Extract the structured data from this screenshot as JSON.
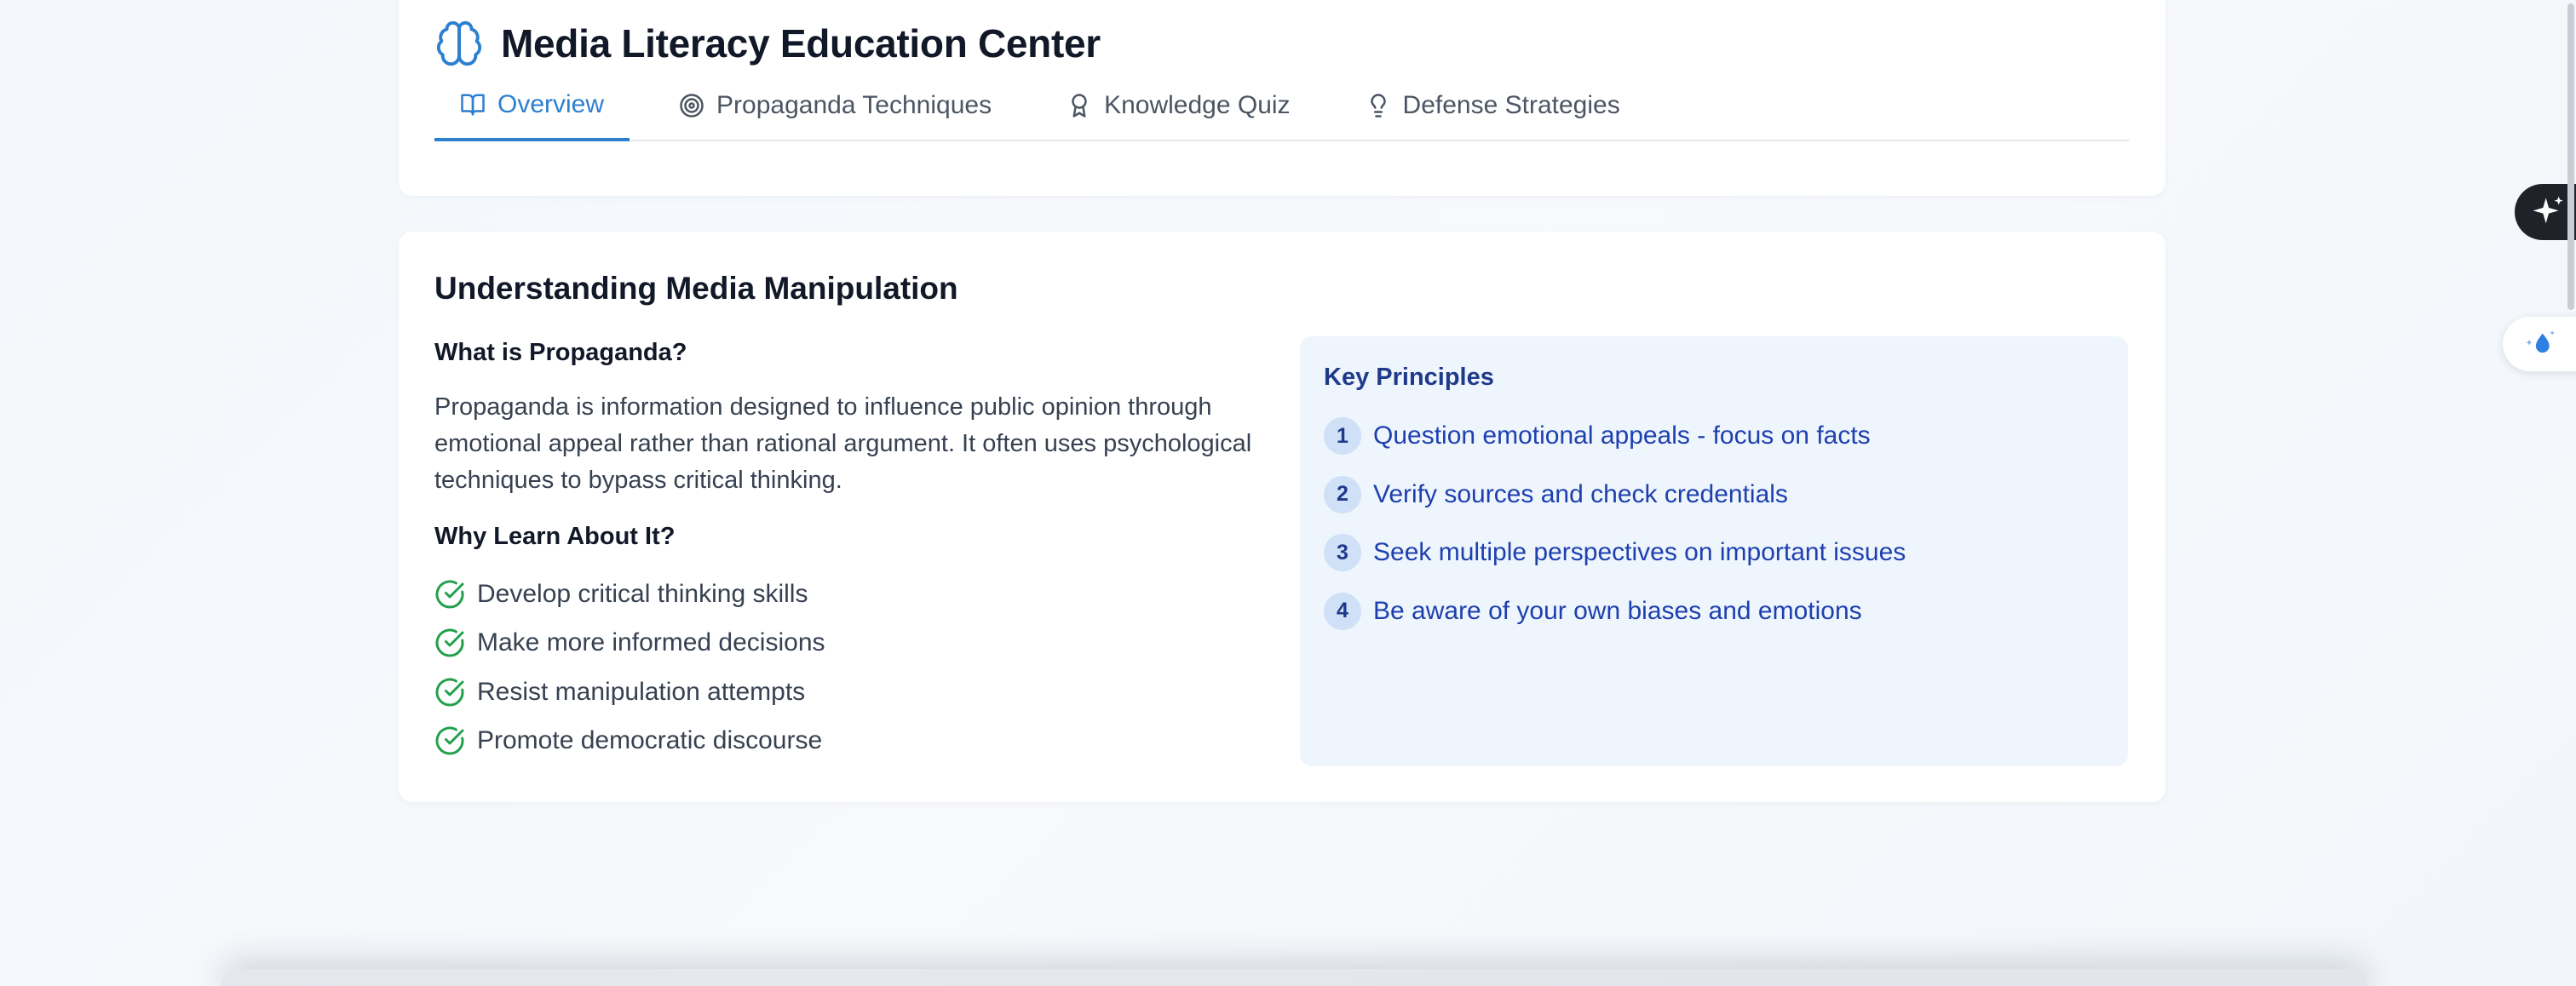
{
  "header": {
    "title": "Media Literacy Education Center",
    "logo_icon": "brain-icon",
    "accent_color": "#2d7fd0"
  },
  "tabs": [
    {
      "label": "Overview",
      "icon": "book-open-icon",
      "active": true
    },
    {
      "label": "Propaganda Techniques",
      "icon": "target-icon",
      "active": false
    },
    {
      "label": "Knowledge Quiz",
      "icon": "award-icon",
      "active": false
    },
    {
      "label": "Defense Strategies",
      "icon": "lightbulb-icon",
      "active": false
    }
  ],
  "overview": {
    "title": "Understanding Media Manipulation",
    "what_heading": "What is Propaganda?",
    "what_text": "Propaganda is information designed to influence public opinion through emotional appeal rather than rational argument. It often uses psychological techniques to bypass critical thinking.",
    "why_heading": "Why Learn About It?",
    "benefits": [
      "Develop critical thinking skills",
      "Make more informed decisions",
      "Resist manipulation attempts",
      "Promote democratic discourse"
    ],
    "benefit_icon": "check-circle-icon",
    "benefit_icon_color": "#22a04b"
  },
  "principles": {
    "title": "Key Principles",
    "items": [
      {
        "num": "1",
        "text": "Question emotional appeals - focus on facts"
      },
      {
        "num": "2",
        "text": "Verify sources and check credentials"
      },
      {
        "num": "3",
        "text": "Seek multiple perspectives on important issues"
      },
      {
        "num": "4",
        "text": "Be aware of your own biases and emotions"
      }
    ]
  },
  "floating": {
    "dark_button_icon": "sparkle-icon",
    "light_button_icon": "droplet-sparkle-icon"
  }
}
